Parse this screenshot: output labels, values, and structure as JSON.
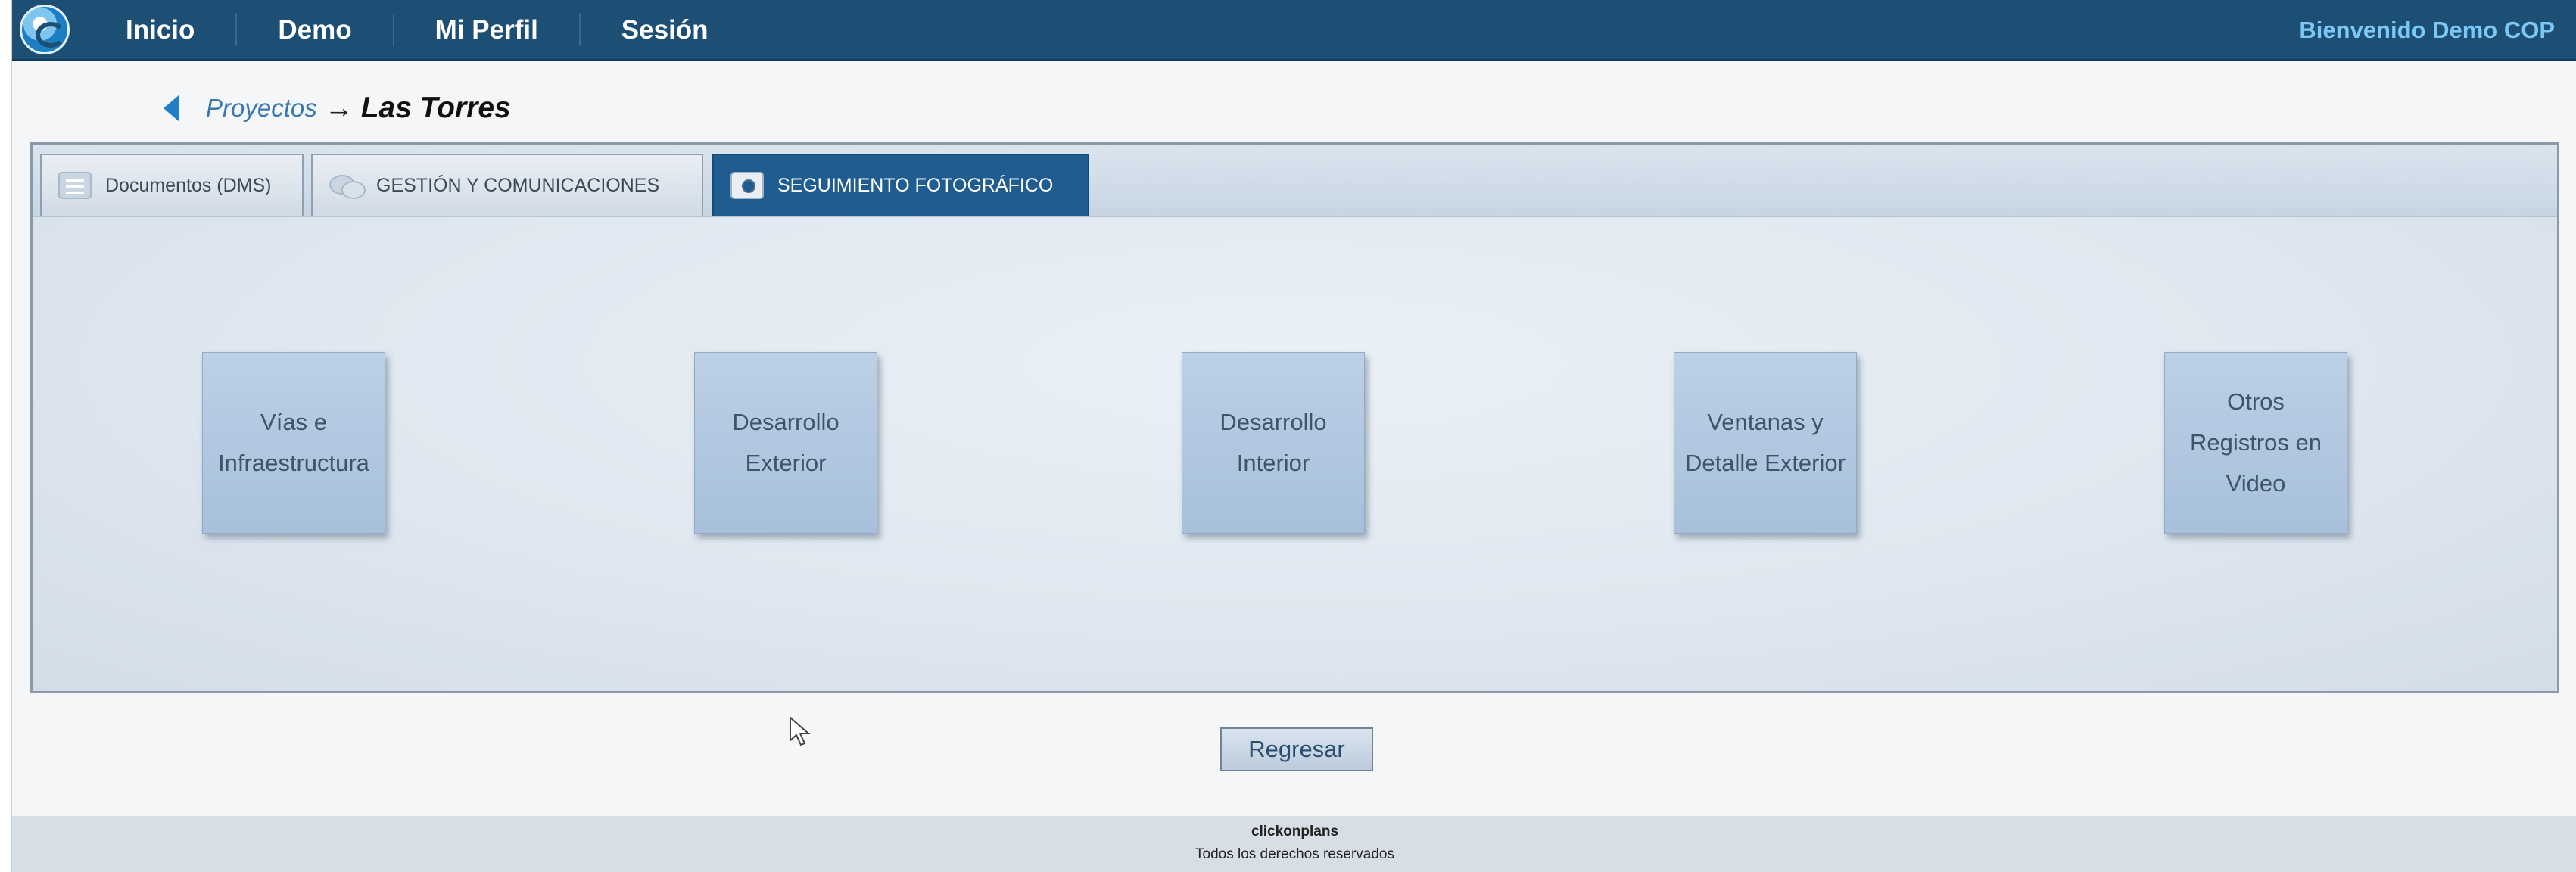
{
  "nav": {
    "items": [
      {
        "label": "Inicio"
      },
      {
        "label": "Demo"
      },
      {
        "label": "Mi Perfil"
      },
      {
        "label": "Sesión"
      }
    ],
    "welcome": "Bienvenido Demo COP"
  },
  "breadcrumb": {
    "link": "Proyectos",
    "separator": "→",
    "current": "Las Torres"
  },
  "tabs": [
    {
      "label": "Documentos (DMS)",
      "icon": "document-icon"
    },
    {
      "label": "GESTIÓN Y COMUNICACIONES",
      "icon": "chat-icon"
    },
    {
      "label": "SEGUIMIENTO FOTOGRÁFICO",
      "icon": "camera-icon",
      "active": true
    }
  ],
  "categories": [
    {
      "label": "Vías e\nInfraestructura"
    },
    {
      "label": "Desarrollo\nExterior"
    },
    {
      "label": "Desarrollo\nInterior"
    },
    {
      "label": "Ventanas y\nDetalle Exterior"
    },
    {
      "label": "Otros\nRegistros en\nVideo"
    }
  ],
  "back_button": "Regresar",
  "footer": {
    "brand": "clickonplans",
    "rights": "Todos los derechos reservados"
  },
  "colors": {
    "topbar": "#1d4f75",
    "welcome": "#7cc8f4",
    "active_tab": "#1f5c8f",
    "category_button": "#b2c8e1"
  }
}
